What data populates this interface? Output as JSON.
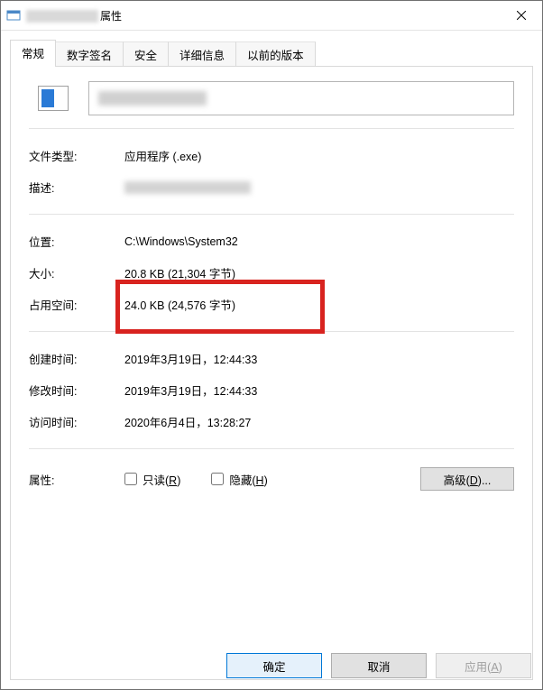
{
  "window": {
    "title_suffix": "属性"
  },
  "tabs": {
    "general": "常规",
    "signatures": "数字签名",
    "security": "安全",
    "details": "详细信息",
    "previous": "以前的版本"
  },
  "labels": {
    "file_type": "文件类型:",
    "description": "描述:",
    "location": "位置:",
    "size": "大小:",
    "size_on_disk": "占用空间:",
    "created": "创建时间:",
    "modified": "修改时间:",
    "accessed": "访问时间:",
    "attributes": "属性:"
  },
  "values": {
    "file_type": "应用程序 (.exe)",
    "location": "C:\\Windows\\System32",
    "size": "20.8 KB (21,304 字节)",
    "size_on_disk": "24.0 KB (24,576 字节)",
    "created": "2019年3月19日，12:44:33",
    "modified": "2019年3月19日，12:44:33",
    "accessed": "2020年6月4日，13:28:27"
  },
  "attrs": {
    "readonly_label": "只读(",
    "readonly_key": "R",
    "readonly_close": ")",
    "hidden_label": "隐藏(",
    "hidden_key": "H",
    "hidden_close": ")",
    "advanced_label": "高级(",
    "advanced_key": "D",
    "advanced_close": ")..."
  },
  "buttons": {
    "ok": "确定",
    "cancel": "取消",
    "apply_label": "应用(",
    "apply_key": "A",
    "apply_close": ")"
  }
}
